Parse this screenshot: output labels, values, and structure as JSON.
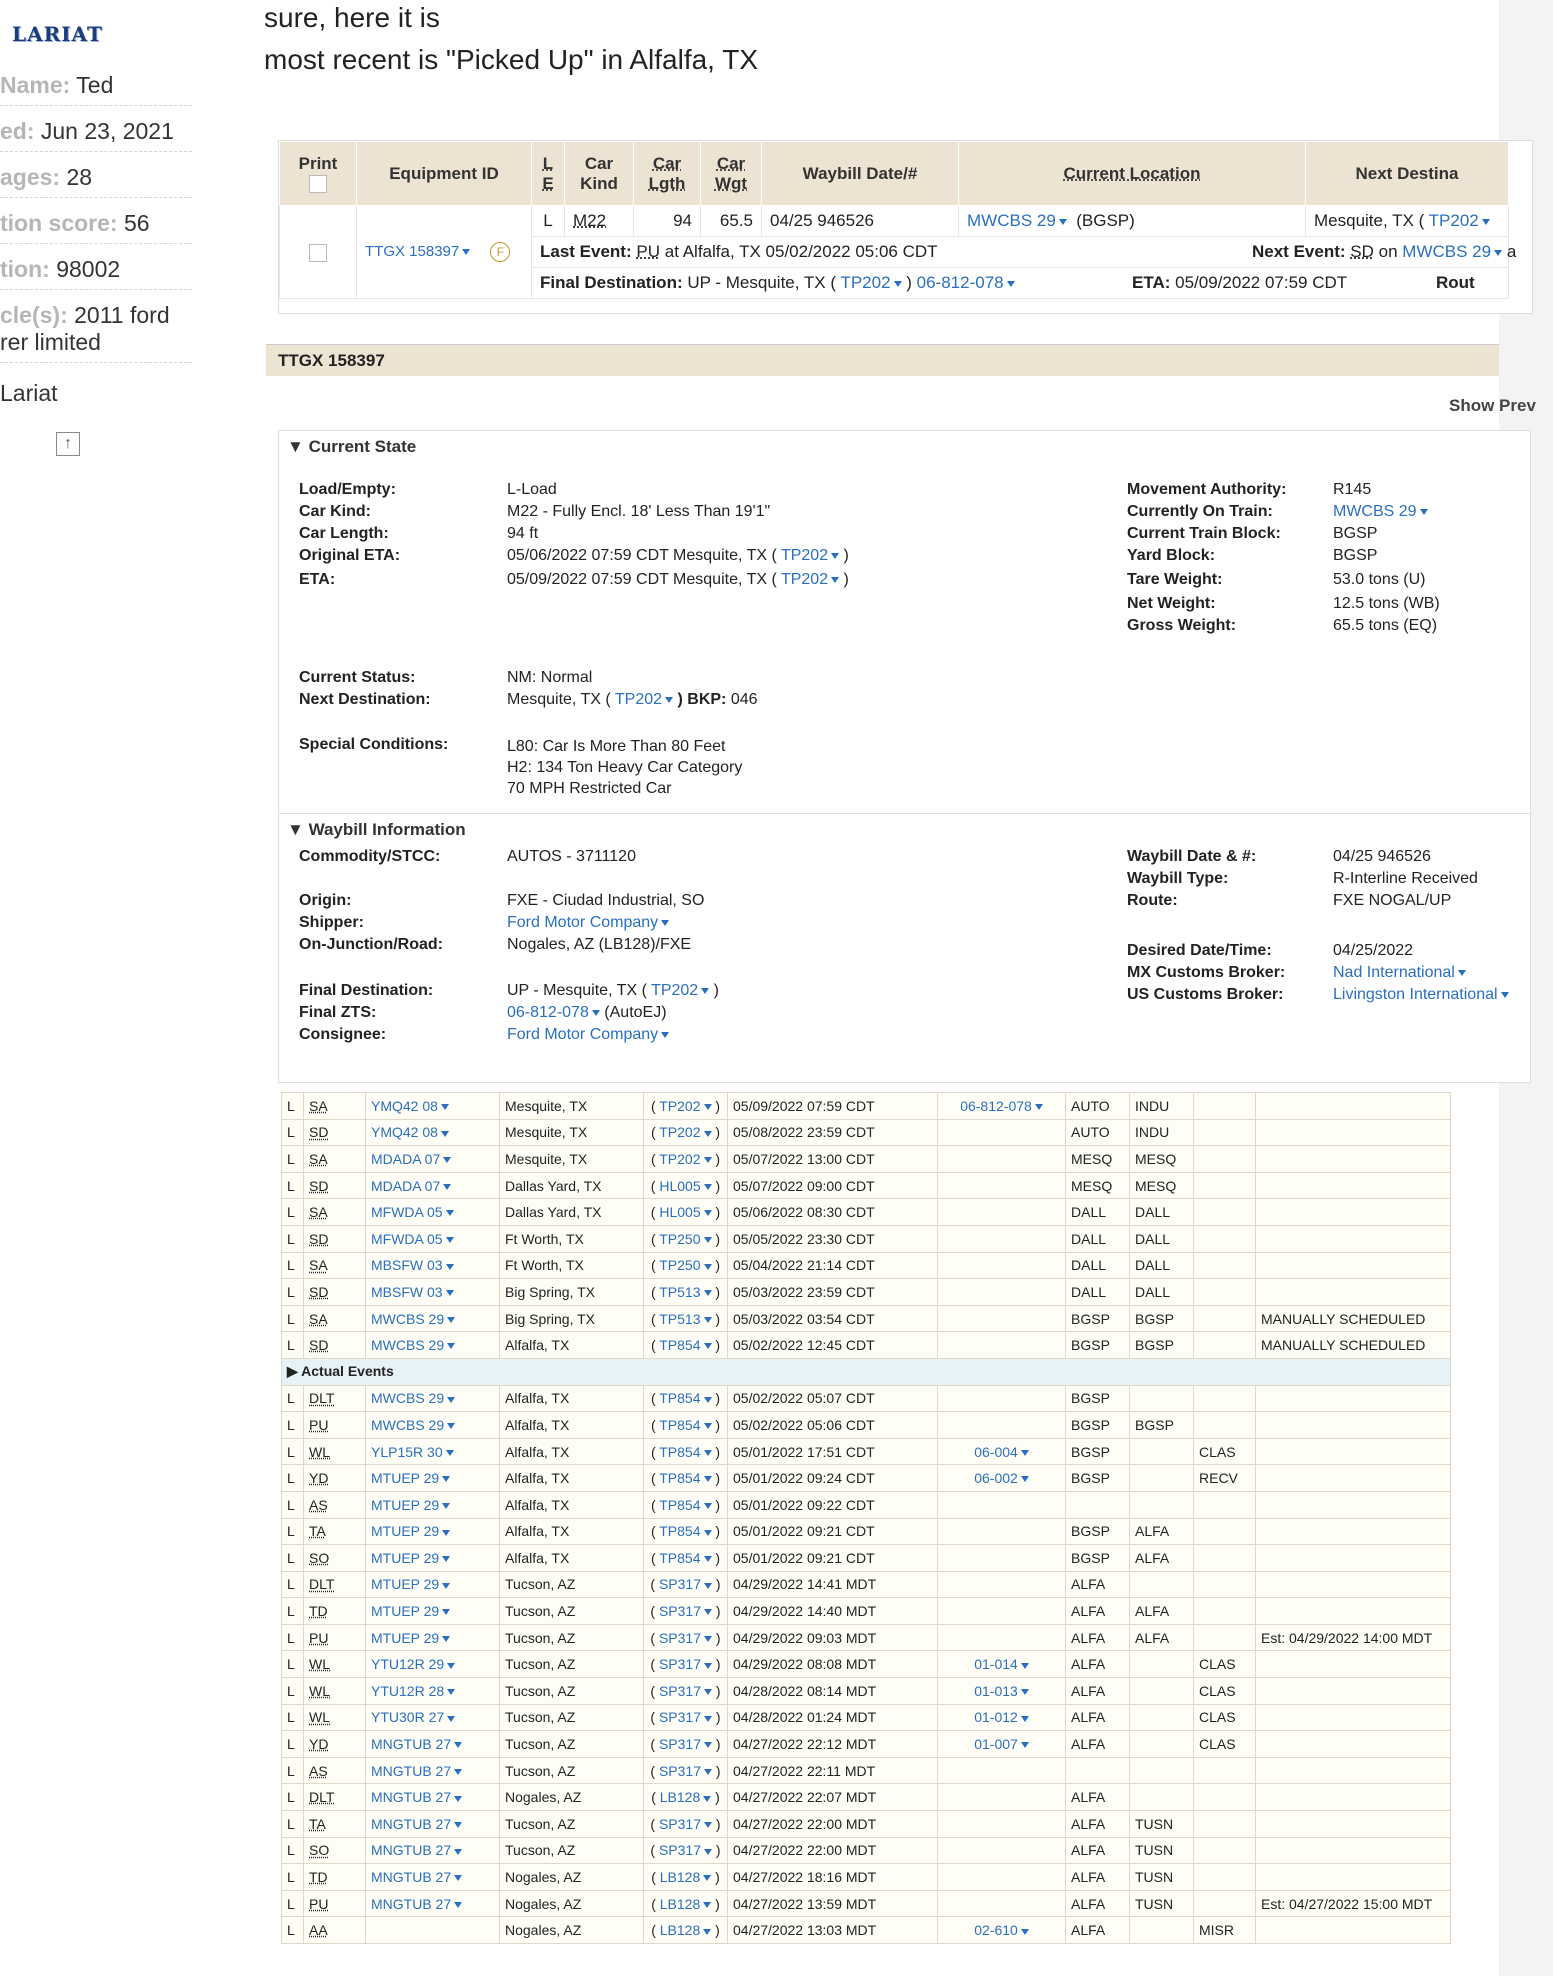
{
  "sidebar": {
    "brand": "LARIAT",
    "profile": [
      {
        "k": "Name:",
        "v": "Ted"
      },
      {
        "k": "ed:",
        "v": "Jun 23, 2021"
      },
      {
        "k": "ages:",
        "v": "28"
      },
      {
        "k": "tion score:",
        "v": "56"
      },
      {
        "k": "tion:",
        "v": "98002"
      },
      {
        "k": "cle(s):",
        "v": "2011 ford",
        "v2": "rer limited"
      },
      {
        "k": "",
        "v": " Lariat"
      }
    ],
    "up_icon": "arrow-up-icon"
  },
  "message": {
    "line1": "sure, here it is",
    "line2": "most recent is \"Picked Up\" in Alfalfa, TX"
  },
  "equipment": {
    "headers": [
      "Print",
      "Equipment ID",
      "L E",
      "Car Kind",
      "Car Lgth",
      "Car Wgt",
      "Waybill Date/#",
      "Current Location",
      "Next Destina"
    ],
    "row": {
      "le": "L",
      "kind": "M22",
      "lgth": "94",
      "wgt": "65.5",
      "waybill": "04/25 946526",
      "cur_loc": "MWCBS 29",
      "cur_loc2": "(BGSP)",
      "next": "Mesquite, TX (",
      "next_link": "TP202",
      "id": "TTGX  158397",
      "f_badge": "F",
      "last_event_label": "Last Event:",
      "last_event_code": "PU",
      "last_event": "at Alfalfa, TX 05/02/2022 05:06 CDT",
      "next_event_label": "Next Event:",
      "next_event_code": "SD",
      "next_event_on": "on",
      "next_event_link": "MWCBS 29",
      "next_event_tail": "a",
      "final_label": "Final Destination:",
      "final": "UP - Mesquite, TX (",
      "final_link": "TP202",
      "final_zts": "06-812-078",
      "eta_label": "ETA:",
      "eta": "05/09/2022 07:59 CDT",
      "route_label": "Rout"
    }
  },
  "ttgx_bar": "TTGX 158397",
  "show_prev": "Show Prev",
  "current_state": {
    "title": "Current State",
    "left": [
      {
        "k": "Load/Empty:",
        "v": "L-Load"
      },
      {
        "k": "Car Kind:",
        "v": "M22 - Fully Encl. 18' Less Than 19'1\""
      },
      {
        "k": "Car Length:",
        "v": "94 ft"
      },
      {
        "k": "Original ETA:",
        "v": "05/06/2022 07:59 CDT Mesquite, TX (",
        "link": "TP202",
        "tail": ")"
      },
      {
        "k": "ETA:",
        "v": "05/09/2022 07:59 CDT Mesquite, TX (",
        "link": "TP202",
        "tail": ")"
      }
    ],
    "status_label": "Current Status:",
    "status": "NM: Normal",
    "nextdest_label": "Next Destination:",
    "nextdest": "Mesquite, TX (",
    "nextdest_link": "TP202",
    "bkp_label": ") BKP:",
    "bkp": "046",
    "special_label": "Special Conditions:",
    "special": [
      "L80: Car Is More Than 80 Feet",
      "H2: 134 Ton Heavy Car Category",
      "70 MPH Restricted Car"
    ],
    "right": [
      {
        "k": "Movement Authority:",
        "v": "R145"
      },
      {
        "k": "Currently On Train:",
        "v": "MWCBS 29",
        "link": true
      },
      {
        "k": "Current Train Block:",
        "v": "BGSP"
      },
      {
        "k": "Yard Block:",
        "v": "BGSP"
      },
      {
        "k": "Tare Weight:",
        "v": "53.0 tons (U)"
      },
      {
        "k": "Net Weight:",
        "v": "12.5 tons (WB)"
      },
      {
        "k": "Gross Weight:",
        "v": "65.5 tons (EQ)"
      }
    ]
  },
  "waybill": {
    "title": "Waybill Information",
    "left": [
      {
        "k": "Commodity/STCC:",
        "v": "AUTOS - 3711120"
      },
      {
        "k": "Origin:",
        "v": "FXE - Ciudad Industrial, SO"
      },
      {
        "k": "Shipper:",
        "v": "Ford Motor Company",
        "link": true
      },
      {
        "k": "On-Junction/Road:",
        "v": "Nogales, AZ (LB128)/FXE"
      },
      {
        "k": "Final Destination:",
        "v": "UP - Mesquite, TX (",
        "link2": "TP202",
        "tail": ")"
      },
      {
        "k": "Final ZTS:",
        "v": "06-812-078",
        "link": true,
        "tail": "(AutoEJ)"
      },
      {
        "k": "Consignee:",
        "v": "Ford Motor Company",
        "link": true
      }
    ],
    "right": [
      {
        "k": "Waybill Date & #:",
        "v": "04/25 946526"
      },
      {
        "k": "Waybill Type:",
        "v": "R-Interline Received"
      },
      {
        "k": "Route:",
        "v": "FXE NOGAL/UP"
      },
      {
        "k": "Desired Date/Time:",
        "v": "04/25/2022"
      },
      {
        "k": "MX Customs Broker:",
        "v": "Nad International",
        "link": true
      },
      {
        "k": "US Customs Broker:",
        "v": "Livingston International",
        "link": true
      }
    ]
  },
  "events": {
    "section_label": "Actual Events",
    "planned": [
      [
        "L",
        "SA",
        "YMQ42 08",
        "Mesquite, TX",
        "TP202",
        "05/09/2022 07:59 CDT",
        "06-812-078",
        "AUTO",
        "INDU",
        "",
        ""
      ],
      [
        "L",
        "SD",
        "YMQ42 08",
        "Mesquite, TX",
        "TP202",
        "05/08/2022 23:59 CDT",
        "",
        "AUTO",
        "INDU",
        "",
        ""
      ],
      [
        "L",
        "SA",
        "MDADA 07",
        "Mesquite, TX",
        "TP202",
        "05/07/2022 13:00 CDT",
        "",
        "MESQ",
        "MESQ",
        "",
        ""
      ],
      [
        "L",
        "SD",
        "MDADA 07",
        "Dallas Yard, TX",
        "HL005",
        "05/07/2022 09:00 CDT",
        "",
        "MESQ",
        "MESQ",
        "",
        ""
      ],
      [
        "L",
        "SA",
        "MFWDA 05",
        "Dallas Yard, TX",
        "HL005",
        "05/06/2022 08:30 CDT",
        "",
        "DALL",
        "DALL",
        "",
        ""
      ],
      [
        "L",
        "SD",
        "MFWDA 05",
        "Ft Worth, TX",
        "TP250",
        "05/05/2022 23:30 CDT",
        "",
        "DALL",
        "DALL",
        "",
        ""
      ],
      [
        "L",
        "SA",
        "MBSFW 03",
        "Ft Worth, TX",
        "TP250",
        "05/04/2022 21:14 CDT",
        "",
        "DALL",
        "DALL",
        "",
        ""
      ],
      [
        "L",
        "SD",
        "MBSFW 03",
        "Big Spring, TX",
        "TP513",
        "05/03/2022 23:59 CDT",
        "",
        "DALL",
        "DALL",
        "",
        ""
      ],
      [
        "L",
        "SA",
        "MWCBS 29",
        "Big Spring, TX",
        "TP513",
        "05/03/2022 03:54 CDT",
        "",
        "BGSP",
        "BGSP",
        "",
        "MANUALLY SCHEDULED"
      ],
      [
        "L",
        "SD",
        "MWCBS 29",
        "Alfalfa, TX",
        "TP854",
        "05/02/2022 12:45 CDT",
        "",
        "BGSP",
        "BGSP",
        "",
        "MANUALLY SCHEDULED"
      ]
    ],
    "actual": [
      [
        "L",
        "DLT",
        "MWCBS 29",
        "Alfalfa, TX",
        "TP854",
        "05/02/2022 05:07 CDT",
        "",
        "BGSP",
        "",
        "",
        ""
      ],
      [
        "L",
        "PU",
        "MWCBS 29",
        "Alfalfa, TX",
        "TP854",
        "05/02/2022 05:06 CDT",
        "",
        "BGSP",
        "BGSP",
        "",
        ""
      ],
      [
        "L",
        "WL",
        "YLP15R 30",
        "Alfalfa, TX",
        "TP854",
        "05/01/2022 17:51 CDT",
        "06-004",
        "BGSP",
        "",
        "CLAS",
        ""
      ],
      [
        "L",
        "YD",
        "MTUEP 29",
        "Alfalfa, TX",
        "TP854",
        "05/01/2022 09:24 CDT",
        "06-002",
        "BGSP",
        "",
        "RECV",
        ""
      ],
      [
        "L",
        "AS",
        "MTUEP 29",
        "Alfalfa, TX",
        "TP854",
        "05/01/2022 09:22 CDT",
        "",
        "",
        "",
        "",
        ""
      ],
      [
        "L",
        "TA",
        "MTUEP 29",
        "Alfalfa, TX",
        "TP854",
        "05/01/2022 09:21 CDT",
        "",
        "BGSP",
        "ALFA",
        "",
        ""
      ],
      [
        "L",
        "SO",
        "MTUEP 29",
        "Alfalfa, TX",
        "TP854",
        "05/01/2022 09:21 CDT",
        "",
        "BGSP",
        "ALFA",
        "",
        ""
      ],
      [
        "L",
        "DLT",
        "MTUEP 29",
        "Tucson, AZ",
        "SP317",
        "04/29/2022 14:41 MDT",
        "",
        "ALFA",
        "",
        "",
        ""
      ],
      [
        "L",
        "TD",
        "MTUEP 29",
        "Tucson, AZ",
        "SP317",
        "04/29/2022 14:40 MDT",
        "",
        "ALFA",
        "ALFA",
        "",
        ""
      ],
      [
        "L",
        "PU",
        "MTUEP 29",
        "Tucson, AZ",
        "SP317",
        "04/29/2022 09:03 MDT",
        "",
        "ALFA",
        "ALFA",
        "",
        "Est: 04/29/2022 14:00 MDT"
      ],
      [
        "L",
        "WL",
        "YTU12R 29",
        "Tucson, AZ",
        "SP317",
        "04/29/2022 08:08 MDT",
        "01-014",
        "ALFA",
        "",
        "CLAS",
        ""
      ],
      [
        "L",
        "WL",
        "YTU12R 28",
        "Tucson, AZ",
        "SP317",
        "04/28/2022 08:14 MDT",
        "01-013",
        "ALFA",
        "",
        "CLAS",
        ""
      ],
      [
        "L",
        "WL",
        "YTU30R 27",
        "Tucson, AZ",
        "SP317",
        "04/28/2022 01:24 MDT",
        "01-012",
        "ALFA",
        "",
        "CLAS",
        ""
      ],
      [
        "L",
        "YD",
        "MNGTUB 27",
        "Tucson, AZ",
        "SP317",
        "04/27/2022 22:12 MDT",
        "01-007",
        "ALFA",
        "",
        "CLAS",
        ""
      ],
      [
        "L",
        "AS",
        "MNGTUB 27",
        "Tucson, AZ",
        "SP317",
        "04/27/2022 22:11 MDT",
        "",
        "",
        "",
        "",
        ""
      ],
      [
        "L",
        "DLT",
        "MNGTUB 27",
        "Nogales, AZ",
        "LB128",
        "04/27/2022 22:07 MDT",
        "",
        "ALFA",
        "",
        "",
        ""
      ],
      [
        "L",
        "TA",
        "MNGTUB 27",
        "Tucson, AZ",
        "SP317",
        "04/27/2022 22:00 MDT",
        "",
        "ALFA",
        "TUSN",
        "",
        ""
      ],
      [
        "L",
        "SO",
        "MNGTUB 27",
        "Tucson, AZ",
        "SP317",
        "04/27/2022 22:00 MDT",
        "",
        "ALFA",
        "TUSN",
        "",
        ""
      ],
      [
        "L",
        "TD",
        "MNGTUB 27",
        "Nogales, AZ",
        "LB128",
        "04/27/2022 18:16 MDT",
        "",
        "ALFA",
        "TUSN",
        "",
        ""
      ],
      [
        "L",
        "PU",
        "MNGTUB 27",
        "Nogales, AZ",
        "LB128",
        "04/27/2022 13:59 MDT",
        "",
        "ALFA",
        "TUSN",
        "",
        "Est: 04/27/2022 15:00 MDT"
      ],
      [
        "L",
        "AA",
        "",
        "Nogales, AZ",
        "LB128",
        "04/27/2022 13:03 MDT",
        "02-610",
        "ALFA",
        "",
        "MISR",
        ""
      ]
    ]
  },
  "colors": {
    "link": "#2a6fbf",
    "header_bg": "#ede3d2",
    "section_bg": "#e6f1f8"
  }
}
